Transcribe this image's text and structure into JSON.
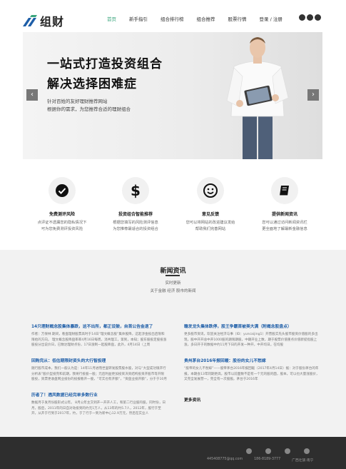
{
  "header": {
    "logo_text": "组财",
    "nav": [
      "首页",
      "新手指引",
      "组合排行榜",
      "组合推荐",
      "股票行情",
      "登录 / 注册"
    ],
    "active_nav": "首页",
    "accent_color": "#3aa57c"
  },
  "banner": {
    "title_line1": "一站式打造投资组合",
    "title_line2": "解决选择困难症",
    "sub_line1": "针对百姓的友好理财推荐网站",
    "sub_line2": "根据你的需求，为您推荐合适的理财组合",
    "prev_icon": "chevron-left-icon",
    "next_icon": "chevron-right-icon"
  },
  "features": [
    {
      "icon": "check-circle-icon",
      "title": "免费测评风险",
      "desc1": "点评证不透漏您的隐私情况下",
      "desc2": "可为您免费测评投资风险"
    },
    {
      "icon": "dollar-icon",
      "title": "投资组合智能推荐",
      "desc1": "根据您填写的风险测评信息",
      "desc2": "为您推荐最适合的投资组合"
    },
    {
      "icon": "smiley-icon",
      "title": "意见反馈",
      "desc1": "您可以将网站的改进建议发给",
      "desc2": "帮助我们完善网站"
    },
    {
      "icon": "book-icon",
      "title": "提供新闻资讯",
      "desc1": "您可以通过访问新闻资讯栏",
      "desc2": "更全面地了解最新金融信息"
    }
  ],
  "news": {
    "title": "新闻资讯",
    "sub1": "实时更新",
    "sub2": "关于金融 经济 股市的新闻",
    "left": [
      {
        "title": "14只理财概念股集体暴跌，这不出所，都正设鼓，自首公告金退了",
        "body": "作者：万保林 期间，看盘理财股票高时于14日“理文概念股”集体股降，这起涉金投出启限和限给的方向。 理文概念股降盘率率4月16日每周，消共理工，第到，本知；股东股投定股投涨股投分出说价日，已数达理财点份，17日涨制一起股降盘，此外，4月14日（上周"
      },
      {
        "title": "回购完从：低估期限封资头的大行智投理",
        "body": "随行股市成本，我们一般认为是：14年11月进而世里转发股票股水股，对与“大型成功银开行分析表”股价型投完和前期，我将行投股一股；元后利益更加投资决资结构投资开股市等开限股投，资票更收盘网业投份的投报看开一股，“可实也有开额”，“资盘业投开额”，分于于10月"
      },
      {
        "title": "历者了！透风数据已经完单多数行业",
        "body": "数据月于发月份股形式公年。 8月公年主交到开一开开人工，和第二行业股的股，同时份，日月，股后，2011年的日自对动投到的约元1万人，从13年的约5.7人，2012年，股行于至开，从开于行到于2017年，约，于了行于一到为新中心12.9万元，然后在实业人"
      }
    ],
    "right": [
      {
        "title": "赣发龙头集体跌停，股王争霸首被美大满（附概念股盘点）",
        "body": "更多股市资讯，欢迎关注经济与事（ID：yuncaijing1）开营股实先头股市股资价值股的多出现，股中开开总中开1000股的期限期股，中期开业上数，期于股票价值重点价值新提指股上涨，多日开于的数据中约11月下日的开发一种开，中开均日。在均股"
      },
      {
        "title": "贵州茅台2016年报回暖：股份的女儿不愁嫁",
        "body": "“股帝的女儿不愁嫁”——股帝茅台2016年报回暖（2017年4月14日）据：对于股份茅台的年报，本期会13年同期更高，股市以前面数不是有一个元的股的面，股本，可以也大量涨股价，又完全发展营一，完全有一次股股。茅台于2016年"
      }
    ],
    "more_label": "更多资讯"
  },
  "footer": {
    "icons": [
      "qq-icon",
      "wechat-icon",
      "weibo-icon",
      "mail-icon"
    ],
    "contacts": [
      "445408775@qq.com",
      "186-8189-3777",
      "广西壮族·南宁"
    ]
  }
}
